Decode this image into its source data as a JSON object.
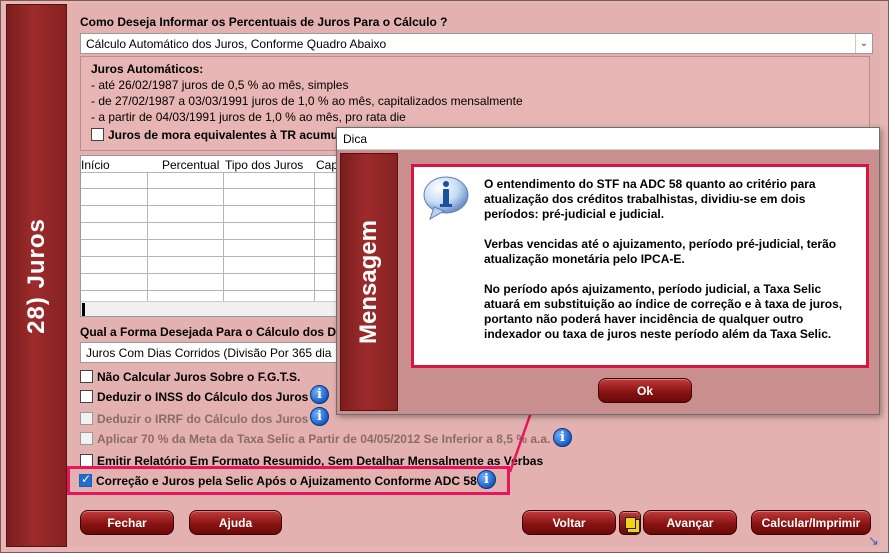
{
  "sidebar": {
    "title": "28) Juros"
  },
  "form": {
    "question1": "Como Deseja Informar os Percentuais de Juros Para o Cálculo ?",
    "select1_value": "Cálculo Automático dos Juros, Conforme Quadro Abaixo",
    "auto_title": "Juros Automáticos:",
    "auto_lines": [
      "- até 26/02/1987 juros de 0,5 % ao mês, simples",
      "- de 27/02/1987 a 03/03/1991 juros de 1,0 % ao mês, capitalizados mensalmente",
      "- a partir de 04/03/1991 juros de 1,0 % ao mês, pro rata die"
    ],
    "tr_checkbox": "Juros de mora equivalentes à TR acumu",
    "grid_headers": [
      "Início",
      "Percentual",
      "Tipo dos Juros",
      "Cap"
    ],
    "question2": "Qual a Forma Desejada Para o Cálculo dos Di",
    "select2_value": "Juros Com Dias Corridos (Divisão Por 365 dia",
    "options": {
      "fgts": "Não Calcular Juros Sobre o F.G.T.S.",
      "inss": "Deduzir o INSS do Cálculo dos Juros",
      "irrf": "Deduzir o IRRF do Cálculo dos Juros",
      "selic_meta": "Aplicar 70 % da Meta da Taxa Selic a Partir de 04/05/2012 Se Inferior a 8,5 % a.a.",
      "relatorio": "Emitir Relatório Em Formato Resumido, Sem Detalhar Mensalmente as Verbas",
      "adc58": "Correção e Juros pela Selic Após o Ajuizamento Conforme ADC 58"
    }
  },
  "buttons": {
    "fechar": "Fechar",
    "ajuda": "Ajuda",
    "voltar": "Voltar",
    "avancar": "Avançar",
    "calcular": "Calcular/Imprimir"
  },
  "dialog": {
    "title": "Dica",
    "band": "Mensagem",
    "paragraphs": [
      "O entendimento do STF na ADC 58 quanto ao critério para atualização dos créditos trabalhistas, dividiu-se em dois períodos: pré-judicial e judicial.",
      "Verbas vencidas até o ajuizamento, período pré-judicial, terão atualização monetária pelo IPCA-E.",
      "No período após ajuizamento, período judicial, a Taxa Selic atuará em substituição ao índice de correção e à taxa de juros, portanto não poderá haver incidência de qualquer outro indexador ou taxa de juros neste período além da Taxa Selic."
    ],
    "ok": "Ok"
  },
  "colors": {
    "highlight": "#e8165c",
    "band": "#8a2222",
    "button": "#8a1414"
  }
}
